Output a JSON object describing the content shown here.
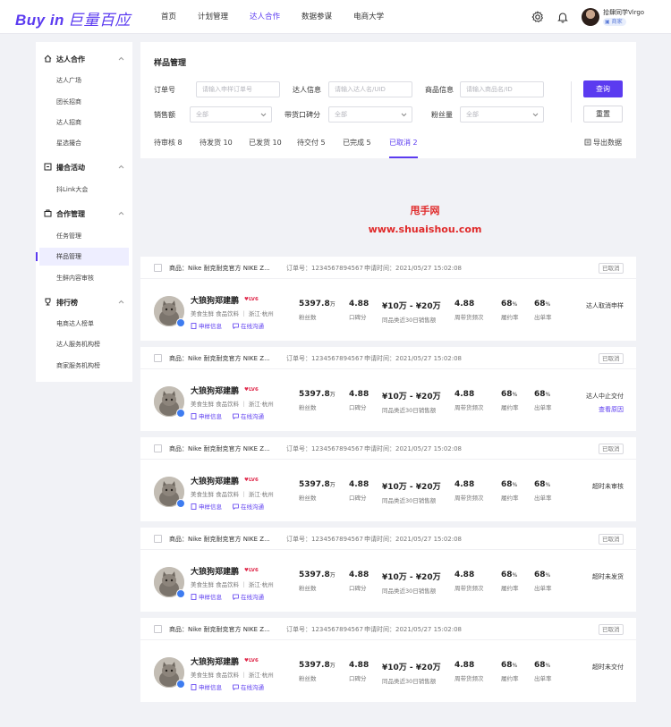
{
  "brand": {
    "logo_en": "Buy in",
    "logo_cn": "巨量百应",
    "accent": "#5b3bf0"
  },
  "nav": [
    {
      "label": "首页",
      "active": false
    },
    {
      "label": "计划管理",
      "active": false
    },
    {
      "label": "达人合作",
      "active": true
    },
    {
      "label": "数据参谋",
      "active": false
    },
    {
      "label": "电商大学",
      "active": false
    }
  ],
  "header_icons": [
    "gear-icon",
    "bell-icon"
  ],
  "user": {
    "name": "拾肆同学Virgo",
    "badge": "商家"
  },
  "sidebar": [
    {
      "title": "达人合作",
      "icon": "home-icon",
      "items": [
        {
          "label": "达人广场",
          "active": false
        },
        {
          "label": "团长招商",
          "active": false
        },
        {
          "label": "达人招商",
          "active": false
        },
        {
          "label": "星选撮合",
          "active": false
        }
      ]
    },
    {
      "title": "撮合活动",
      "icon": "activity-icon",
      "items": [
        {
          "label": "抖Link大会",
          "active": false
        }
      ]
    },
    {
      "title": "合作管理",
      "icon": "briefcase-icon",
      "items": [
        {
          "label": "任务管理",
          "active": false
        },
        {
          "label": "样品管理",
          "active": true
        },
        {
          "label": "生鲜内容审核",
          "active": false
        }
      ]
    },
    {
      "title": "排行榜",
      "icon": "trophy-icon",
      "items": [
        {
          "label": "电商达人榜单",
          "active": false
        },
        {
          "label": "达人服务机构榜",
          "active": false
        },
        {
          "label": "商家服务机构榜",
          "active": false
        }
      ]
    }
  ],
  "filters": {
    "title": "样品管理",
    "order_no": {
      "label": "订单号",
      "placeholder": "请输入申样订单号"
    },
    "talent": {
      "label": "达人信息",
      "placeholder": "请输入达人名/UID"
    },
    "product": {
      "label": "商品信息",
      "placeholder": "请输入商品名/ID"
    },
    "sales": {
      "label": "销售额",
      "value": "全部"
    },
    "rating": {
      "label": "带货口碑分",
      "value": "全部"
    },
    "fans": {
      "label": "粉丝量",
      "value": "全部"
    },
    "query_label": "查询",
    "reset_label": "重置"
  },
  "tabs": [
    {
      "label": "待审核 8",
      "active": false
    },
    {
      "label": "待发货 10",
      "active": false
    },
    {
      "label": "已发货 10",
      "active": false
    },
    {
      "label": "待交付 5",
      "active": false
    },
    {
      "label": "已完成 5",
      "active": false
    },
    {
      "label": "已取消 2",
      "active": true
    }
  ],
  "export_label": "导出数据",
  "watermark": {
    "line1": "甩手网",
    "line2": "www.shuaishou.com"
  },
  "stat_labels": {
    "fans": "粉丝数",
    "rating": "口碑分",
    "sales": "同品类近30日销售额",
    "freq": "周带货频次",
    "fulfil": "履约率",
    "order": "出单率"
  },
  "apply_link": "申样信息",
  "chat_link": "在线沟通",
  "cards": [
    {
      "product": "商品：Nike 耐克耐克官方 NIKE Z...",
      "order_no": "订单号：1234567894567",
      "apply_time": "申请时间：2021/05/27 15:02:08",
      "status": "已取消",
      "name": "大狼狗郑建鹏",
      "level": "LV6",
      "tags": "美食生鲜  食品饮料 ｜ 浙江·杭州",
      "fans": "5397.8",
      "fans_unit": "万",
      "rating": "4.88",
      "sales": "¥10万 - ¥20万",
      "freq": "4.88",
      "fulfil": "68",
      "order": "68",
      "reason": "达人取消申样",
      "reason_link": ""
    },
    {
      "product": "商品：Nike 耐克耐克官方 NIKE Z...",
      "order_no": "订单号：1234567894567",
      "apply_time": "申请时间：2021/05/27 15:02:08",
      "status": "已取消",
      "name": "大狼狗郑建鹏",
      "level": "LV6",
      "tags": "美食生鲜  食品饮料 ｜ 浙江·杭州",
      "fans": "5397.8",
      "fans_unit": "万",
      "rating": "4.88",
      "sales": "¥10万 - ¥20万",
      "freq": "4.88",
      "fulfil": "68",
      "order": "68",
      "reason": "达人中止交付",
      "reason_link": "查看原因"
    },
    {
      "product": "商品：Nike 耐克耐克官方 NIKE Z...",
      "order_no": "订单号：1234567894567",
      "apply_time": "申请时间：2021/05/27 15:02:08",
      "status": "已取消",
      "name": "大狼狗郑建鹏",
      "level": "LV6",
      "tags": "美食生鲜  食品饮料 ｜ 浙江·杭州",
      "fans": "5397.8",
      "fans_unit": "万",
      "rating": "4.88",
      "sales": "¥10万 - ¥20万",
      "freq": "4.88",
      "fulfil": "68",
      "order": "68",
      "reason": "超时未审核",
      "reason_link": ""
    },
    {
      "product": "商品：Nike 耐克耐克官方 NIKE Z...",
      "order_no": "订单号：1234567894567",
      "apply_time": "申请时间：2021/05/27 15:02:08",
      "status": "已取消",
      "name": "大狼狗郑建鹏",
      "level": "LV6",
      "tags": "美食生鲜  食品饮料 ｜ 浙江·杭州",
      "fans": "5397.8",
      "fans_unit": "万",
      "rating": "4.88",
      "sales": "¥10万 - ¥20万",
      "freq": "4.88",
      "fulfil": "68",
      "order": "68",
      "reason": "超时未发货",
      "reason_link": ""
    },
    {
      "product": "商品：Nike 耐克耐克官方 NIKE Z...",
      "order_no": "订单号：1234567894567",
      "apply_time": "申请时间：2021/05/27 15:02:08",
      "status": "已取消",
      "name": "大狼狗郑建鹏",
      "level": "LV6",
      "tags": "美食生鲜  食品饮料 ｜ 浙江·杭州",
      "fans": "5397.8",
      "fans_unit": "万",
      "rating": "4.88",
      "sales": "¥10万 - ¥20万",
      "freq": "4.88",
      "fulfil": "68",
      "order": "68",
      "reason": "超时未交付",
      "reason_link": ""
    }
  ]
}
